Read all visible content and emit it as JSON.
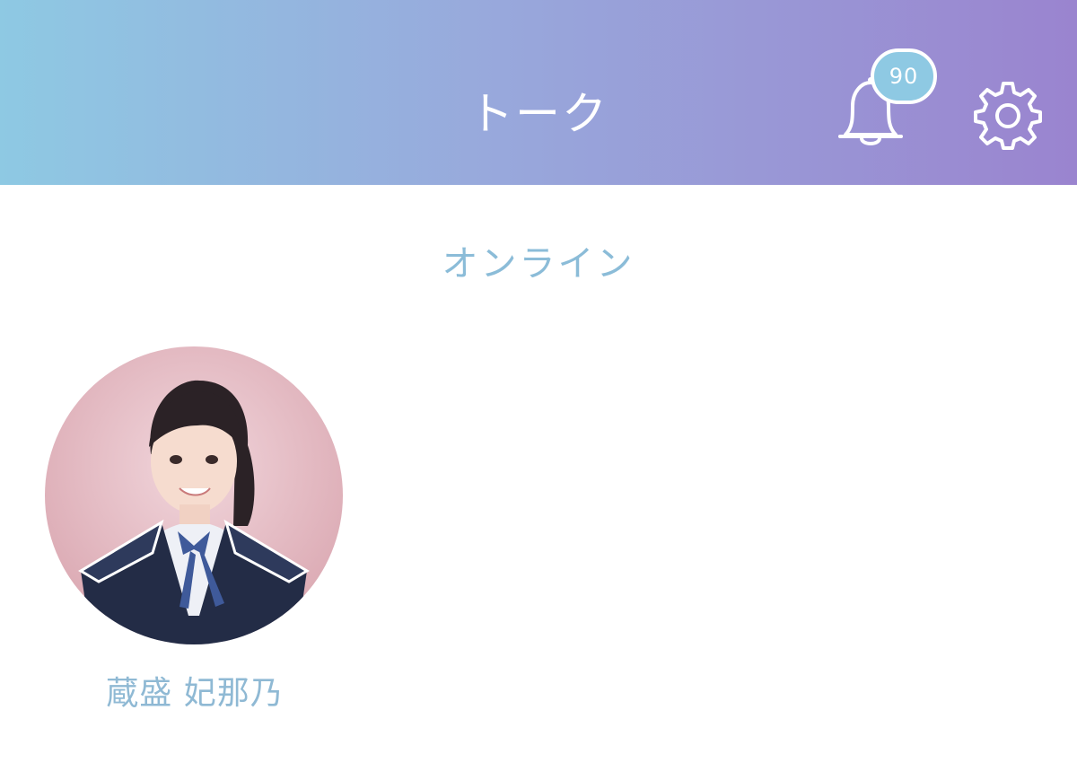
{
  "header": {
    "title": "トーク",
    "notification_count": "90",
    "bell_icon": "bell-icon",
    "settings_icon": "gear-icon"
  },
  "online_section": {
    "title": "オンライン",
    "members": [
      {
        "name": "蔵盛 妃那乃",
        "avatar_icon": "member-photo"
      }
    ]
  },
  "colors": {
    "header_gradient_start": "#8ec9e3",
    "header_gradient_end": "#9a84cf",
    "accent_text": "#8bbcd8",
    "badge_bg": "#8ec9e3"
  }
}
